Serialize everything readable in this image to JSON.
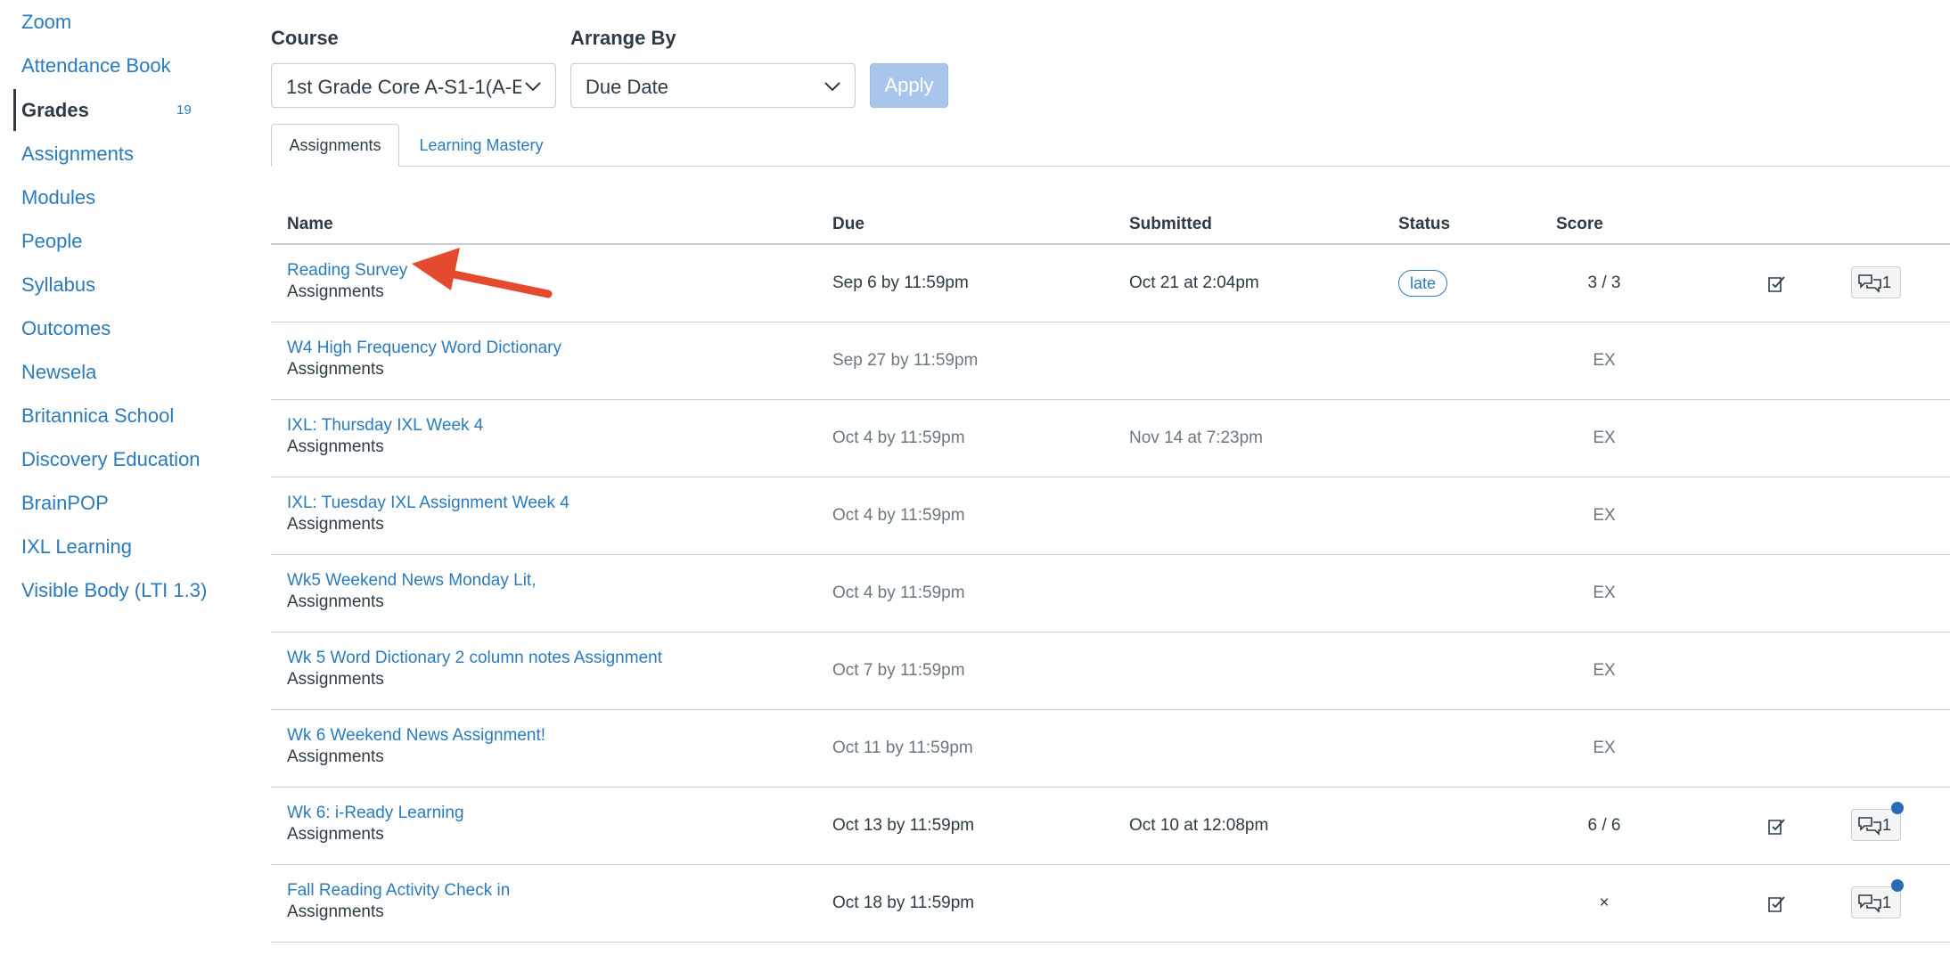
{
  "sidebar": {
    "items": [
      {
        "label": "Zoom"
      },
      {
        "label": "Attendance Book"
      },
      {
        "label": "Grades",
        "badge": "19",
        "active": true
      },
      {
        "label": "Assignments"
      },
      {
        "label": "Modules"
      },
      {
        "label": "People"
      },
      {
        "label": "Syllabus"
      },
      {
        "label": "Outcomes"
      },
      {
        "label": "Newsela"
      },
      {
        "label": "Britannica School"
      },
      {
        "label": "Discovery Education"
      },
      {
        "label": "BrainPOP"
      },
      {
        "label": "IXL Learning"
      },
      {
        "label": "Visible Body (LTI 1.3)"
      }
    ]
  },
  "filters": {
    "course_label": "Course",
    "course_value": "1st Grade Core A-S1-1(A-E",
    "arrange_label": "Arrange By",
    "arrange_value": "Due Date",
    "apply_label": "Apply"
  },
  "tabs": [
    {
      "label": "Assignments",
      "active": true
    },
    {
      "label": "Learning Mastery",
      "active": false
    }
  ],
  "table": {
    "headers": {
      "name": "Name",
      "due": "Due",
      "submitted": "Submitted",
      "status": "Status",
      "score": "Score"
    },
    "rows": [
      {
        "name": "Reading Survey",
        "group": "Assignments",
        "due": "Sep 6 by 11:59pm",
        "submitted": "Oct 21 at 2:04pm",
        "status": "late",
        "score": "3 / 3",
        "rubric": true,
        "comments": "1",
        "unread": false
      },
      {
        "name": "W4 High Frequency Word Dictionary",
        "group": "Assignments",
        "due": "Sep 27 by 11:59pm",
        "submitted": "",
        "status": "",
        "score": "EX",
        "rubric": false,
        "comments": "",
        "unread": false
      },
      {
        "name": "IXL: Thursday IXL Week 4",
        "group": "Assignments",
        "due": "Oct 4 by 11:59pm",
        "submitted": "Nov 14 at 7:23pm",
        "status": "",
        "score": "EX",
        "rubric": false,
        "comments": "",
        "unread": false
      },
      {
        "name": "IXL: Tuesday IXL Assignment Week 4",
        "group": "Assignments",
        "due": "Oct 4 by 11:59pm",
        "submitted": "",
        "status": "",
        "score": "EX",
        "rubric": false,
        "comments": "",
        "unread": false
      },
      {
        "name": "Wk5 Weekend News Monday Lit,",
        "group": "Assignments",
        "due": "Oct 4 by 11:59pm",
        "submitted": "",
        "status": "",
        "score": "EX",
        "rubric": false,
        "comments": "",
        "unread": false
      },
      {
        "name": "Wk 5 Word Dictionary 2 column notes Assignment",
        "group": "Assignments",
        "due": "Oct 7 by 11:59pm",
        "submitted": "",
        "status": "",
        "score": "EX",
        "rubric": false,
        "comments": "",
        "unread": false
      },
      {
        "name": "Wk 6 Weekend News Assignment!",
        "group": "Assignments",
        "due": "Oct 11 by 11:59pm",
        "submitted": "",
        "status": "",
        "score": "EX",
        "rubric": false,
        "comments": "",
        "unread": false
      },
      {
        "name": "Wk 6: i-Ready Learning",
        "group": "Assignments",
        "due": "Oct 13 by 11:59pm",
        "submitted": "Oct 10 at 12:08pm",
        "status": "",
        "score": "6 / 6",
        "rubric": true,
        "comments": "1",
        "unread": true
      },
      {
        "name": "Fall Reading Activity Check in",
        "group": "Assignments",
        "due": "Oct 18 by 11:59pm",
        "submitted": "",
        "status": "",
        "score": "×",
        "rubric": true,
        "comments": "1",
        "unread": true
      }
    ]
  },
  "colors": {
    "link": "#2a7abc",
    "text": "#2d3b45",
    "annotation_arrow": "#e64a2e",
    "unread_dot": "#2a6bb7"
  },
  "icons": {
    "rubric": "rubric-check-icon",
    "comment": "comment-bubbles-icon",
    "dropdown": "chevron-down-icon"
  }
}
